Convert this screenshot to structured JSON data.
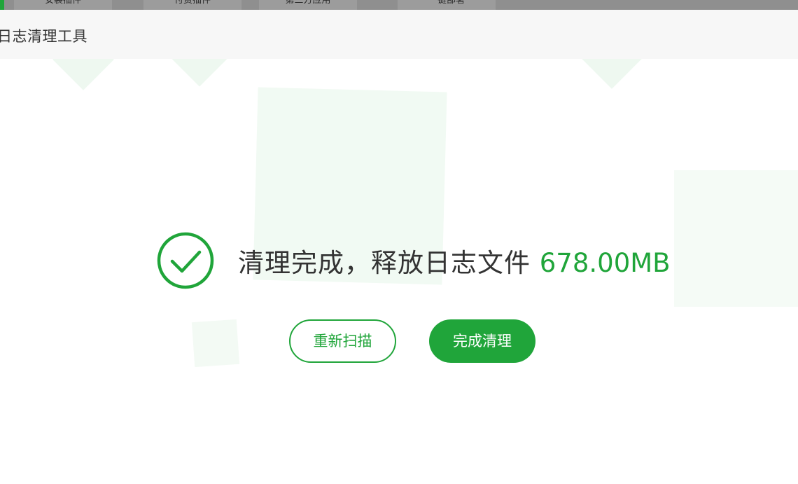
{
  "top_tabs": [
    {
      "label": "安装插件"
    },
    {
      "label": "付费插件"
    },
    {
      "label": "第三方应用"
    },
    {
      "label": "一键部署"
    }
  ],
  "header": {
    "title": "日志清理工具"
  },
  "result": {
    "message": "清理完成，释放日志文件",
    "freed_size": "678.00MB",
    "icon": "check-circle-icon"
  },
  "actions": {
    "rescan_label": "重新扫描",
    "finish_label": "完成清理"
  },
  "colors": {
    "accent": "#20a53a",
    "text": "#333333",
    "header_bg": "#f7f7f7"
  }
}
